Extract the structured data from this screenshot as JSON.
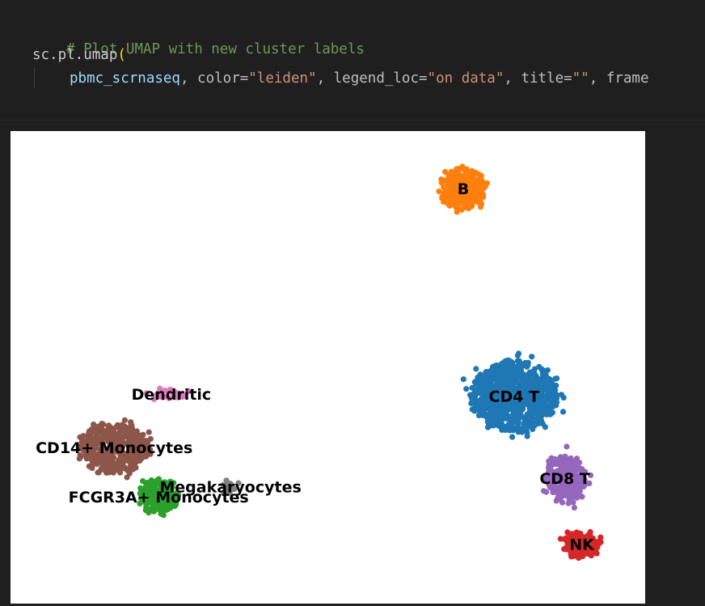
{
  "code": {
    "comment": "# Plot UMAP with new cluster labels",
    "call": "sc.pl.umap",
    "open_paren": "(",
    "arg_object": "pbmc_scrnaseq",
    "sep1": ", ",
    "kw_color": "color=",
    "val_color": "\"leiden\"",
    "sep2": ", ",
    "kw_legend_loc": "legend_loc=",
    "val_legend_loc": "\"on data\"",
    "sep3": ", ",
    "kw_title": "title=",
    "val_title": "\"\"",
    "sep4": ", ",
    "kw_frame_partial": "frame"
  },
  "chart_data": {
    "type": "scatter",
    "title": "",
    "xlabel": "",
    "ylabel": "",
    "grid": false,
    "legend": "on data",
    "clusters": [
      {
        "name": "B",
        "color": "#ff7f0e",
        "center": [
          6.2,
          9.6
        ],
        "spread": [
          1.05,
          0.95
        ],
        "n": 260
      },
      {
        "name": "CD4 T",
        "color": "#1f77b4",
        "center": [
          7.4,
          4.55
        ],
        "spread": [
          2.0,
          1.65
        ],
        "n": 780
      },
      {
        "name": "CD8 T",
        "color": "#9467bd",
        "center": [
          8.6,
          2.55
        ],
        "spread": [
          0.95,
          1.1
        ],
        "n": 230
      },
      {
        "name": "NK",
        "color": "#d62728",
        "center": [
          9.0,
          0.95
        ],
        "spread": [
          0.85,
          0.55
        ],
        "n": 150
      },
      {
        "name": "Dendritic",
        "color": "#e377c2",
        "center": [
          -0.7,
          4.6
        ],
        "spread": [
          0.85,
          0.22
        ],
        "n": 28
      },
      {
        "name": "CD14+ Monocytes",
        "color": "#8c564b",
        "center": [
          -2.05,
          3.3
        ],
        "spread": [
          1.55,
          1.2
        ],
        "n": 420
      },
      {
        "name": "FCGR3A+ Monocytes",
        "color": "#2ca02c",
        "center": [
          -1.0,
          2.1
        ],
        "spread": [
          0.85,
          0.8
        ],
        "n": 220
      },
      {
        "name": "Megakaryocytes",
        "color": "#7f7f7f",
        "center": [
          0.7,
          2.35
        ],
        "spread": [
          0.3,
          0.15
        ],
        "n": 14
      }
    ],
    "xlim": [
      -4.5,
      10.5
    ],
    "ylim": [
      -0.5,
      11
    ]
  }
}
